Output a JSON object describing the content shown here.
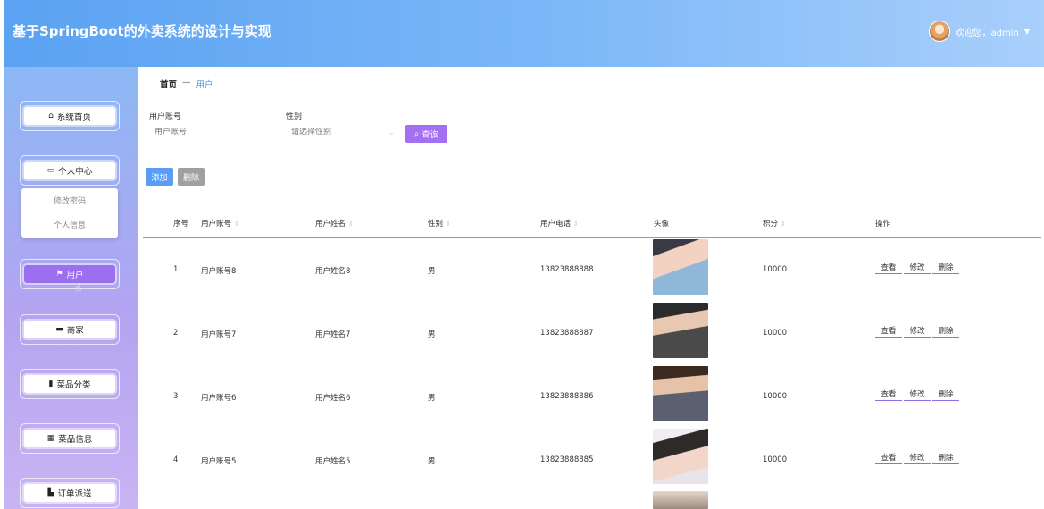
{
  "header": {
    "title": "基于SpringBoot的外卖系统的设计与实现",
    "welcome": "欢迎您，admin"
  },
  "sidebar": {
    "items": [
      {
        "label": "系统首页",
        "icon": "home-icon"
      },
      {
        "label": "个人中心",
        "icon": "card-icon"
      },
      {
        "label": "用户",
        "icon": "flag-icon"
      },
      {
        "label": "商家",
        "icon": "monitor-icon"
      },
      {
        "label": "菜品分类",
        "icon": "clipboard-icon"
      },
      {
        "label": "菜品信息",
        "icon": "grid-icon"
      },
      {
        "label": "订单派送",
        "icon": "truck-icon"
      }
    ],
    "submenu": [
      "修改密码",
      "个人信息"
    ],
    "active_index": 2
  },
  "breadcrumb": {
    "home": "首页",
    "separator": "—",
    "current": "用户"
  },
  "filters": {
    "account_label": "用户账号",
    "account_placeholder": "用户账号",
    "gender_label": "性别",
    "gender_placeholder": "请选择性别",
    "search_label": "查询"
  },
  "actions": {
    "add_label": "添加",
    "delete_label": "删除"
  },
  "table": {
    "headers": [
      "序号",
      "用户账号",
      "用户姓名",
      "性别",
      "用户电话",
      "头像",
      "积分",
      "操作"
    ],
    "row_actions": [
      "查看",
      "修改",
      "删除"
    ],
    "rows": [
      {
        "index": "1",
        "account": "用户账号8",
        "name": "用户姓名8",
        "gender": "男",
        "phone": "13823888888",
        "points": "10000"
      },
      {
        "index": "2",
        "account": "用户账号7",
        "name": "用户姓名7",
        "gender": "男",
        "phone": "13823888887",
        "points": "10000"
      },
      {
        "index": "3",
        "account": "用户账号6",
        "name": "用户姓名6",
        "gender": "男",
        "phone": "13823888886",
        "points": "10000"
      },
      {
        "index": "4",
        "account": "用户账号5",
        "name": "用户姓名5",
        "gender": "男",
        "phone": "13823888885",
        "points": "10000"
      }
    ]
  },
  "colors": {
    "accent": "#a46ff0",
    "primary": "#5a9df2",
    "header": "#7db8f8"
  }
}
